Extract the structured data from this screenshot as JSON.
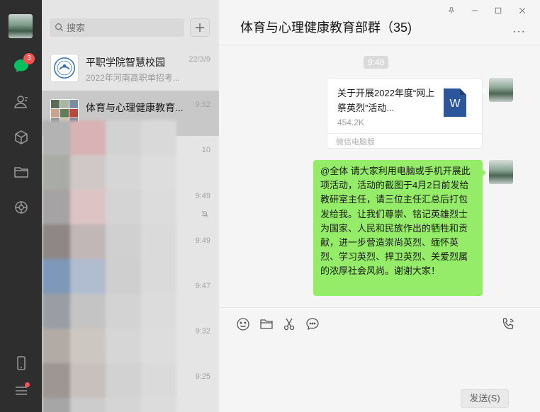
{
  "search": {
    "placeholder": "搜索"
  },
  "nav": {
    "chat_badge": "3"
  },
  "chats": [
    {
      "name": "平职学院智慧校园",
      "preview": "2022年河南高职单招考...",
      "time": "22/3/9"
    },
    {
      "name": "体育与心理健康教育...",
      "preview": "",
      "time": "9:52"
    }
  ],
  "blurred_times": [
    "10",
    "9:49",
    "9:49",
    "9:47",
    "9:32",
    "9:25"
  ],
  "conversation": {
    "title": "体育与心理健康教育部群（35)",
    "more": "···",
    "timestamp": "9:48",
    "file": {
      "title": "关于开展2022年度“网上祭英烈”活动...",
      "size": "454.2K",
      "source": "微信电脑版",
      "icon_letter": "W"
    },
    "message": "@全体  请大家利用电脑或手机开展此项活动，活动的截图于4月2日前发给教研室主任，请三位主任汇总后打包发给我。让我们尊崇、铭记英雄烈士为国家、人民和民族作出的牺牲和贡献，进一步营造崇尚英烈、缅怀英烈、学习英烈、捍卫英烈、关爱烈属的浓厚社会风尚。谢谢大家！"
  },
  "composer": {
    "send_label": "发送(S)"
  },
  "colors": {
    "rail": "#2e2e2e",
    "bubble": "#95ec69",
    "badge": "#fa5151",
    "word": "#2b579a"
  }
}
